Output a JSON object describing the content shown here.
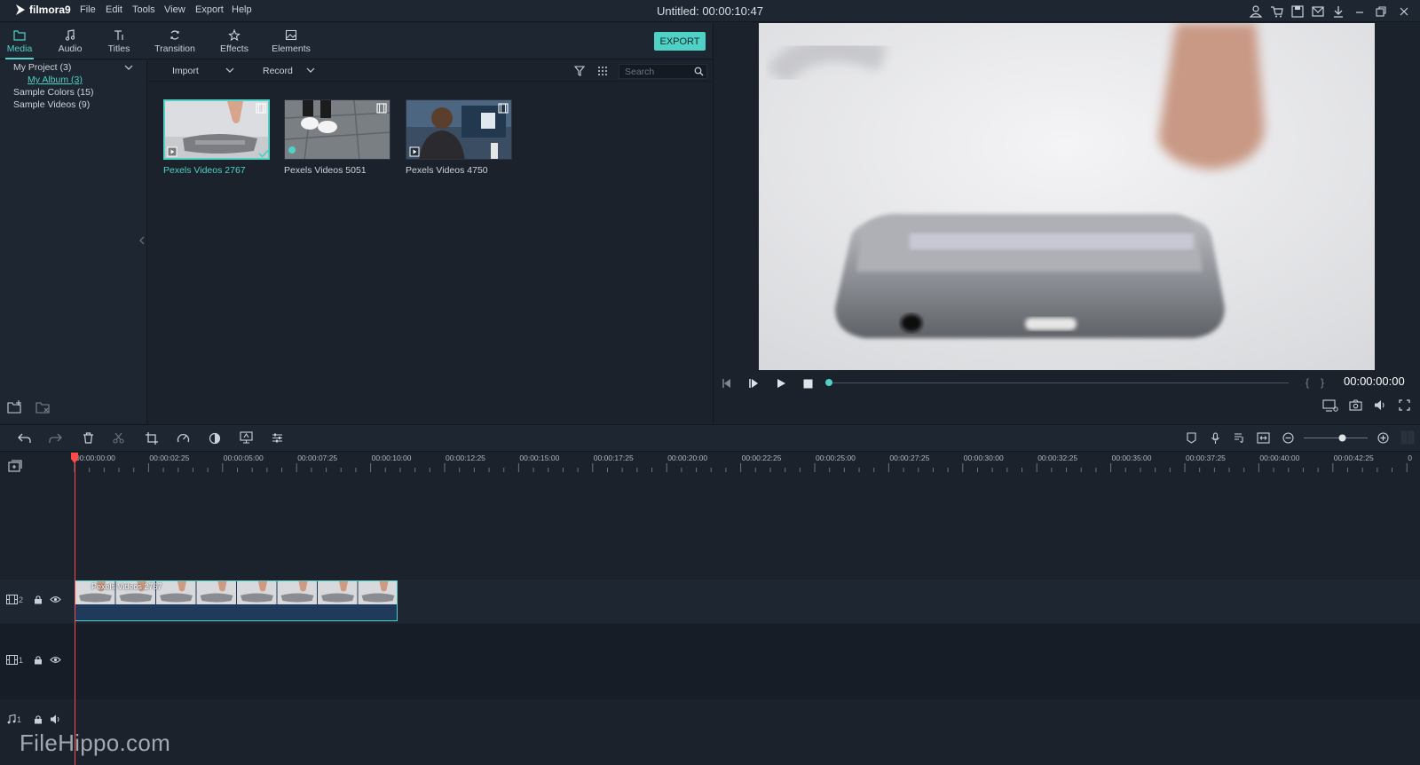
{
  "app": {
    "logo_text": "filmora9",
    "title": "Untitled:",
    "duration": "00:00:10:47",
    "menu": [
      "File",
      "Edit",
      "Tools",
      "View",
      "Export",
      "Help"
    ]
  },
  "tabs": [
    {
      "label": "Media",
      "icon": "folder-icon"
    },
    {
      "label": "Audio",
      "icon": "music-note-icon"
    },
    {
      "label": "Titles",
      "icon": "text-icon"
    },
    {
      "label": "Transition",
      "icon": "transition-icon"
    },
    {
      "label": "Effects",
      "icon": "effects-icon"
    },
    {
      "label": "Elements",
      "icon": "image-icon"
    }
  ],
  "export_label": "EXPORT",
  "tree": {
    "my_project": "My Project (3)",
    "my_album": "My Album (3)",
    "sample_colors": "Sample Colors (15)",
    "sample_videos": "Sample Videos (9)"
  },
  "media_toolbar": {
    "import_label": "Import",
    "record_label": "Record",
    "search_placeholder": "Search"
  },
  "media_items": [
    {
      "name": "Pexels Videos 2767",
      "selected": true
    },
    {
      "name": "Pexels Videos 5051",
      "selected": false
    },
    {
      "name": "Pexels Videos 4750",
      "selected": false
    }
  ],
  "preview": {
    "timecode": "00:00:00:00",
    "progress": 0
  },
  "ruler_labels": [
    "00:00:00:00",
    "00:00:02:25",
    "00:00:05:00",
    "00:00:07:25",
    "00:00:10:00",
    "00:00:12:25",
    "00:00:15:00",
    "00:00:17:25",
    "00:00:20:00",
    "00:00:22:25",
    "00:00:25:00",
    "00:00:27:25",
    "00:00:30:00",
    "00:00:32:25",
    "00:00:35:00",
    "00:00:37:25",
    "00:00:40:00",
    "00:00:42:25",
    "0"
  ],
  "tracks": {
    "video2_num": "2",
    "video1_num": "1",
    "audio1_num": "1",
    "clip_name": "Pexels Videos 2767"
  },
  "watermark": "FileHippo.com",
  "colors": {
    "accent": "#4fd1c5",
    "playhead": "#ff4a4a",
    "panel": "#1b222c"
  }
}
